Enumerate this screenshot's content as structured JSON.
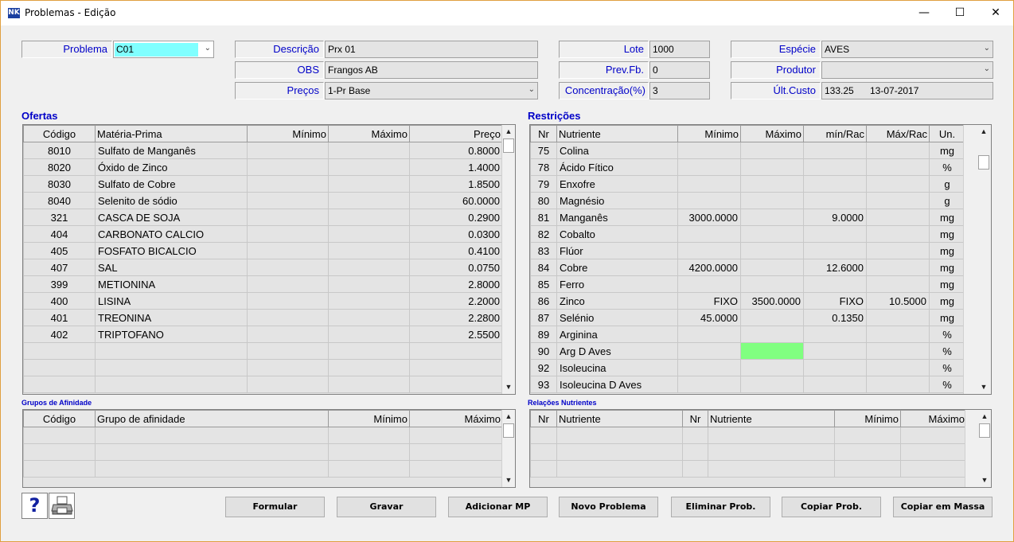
{
  "window": {
    "title": "Problemas - Edição",
    "icon_text": "NK",
    "controls": {
      "minimize": "—",
      "maximize": "☐",
      "close": "✕"
    }
  },
  "header": {
    "problema": {
      "label": "Problema",
      "value": "C01"
    },
    "descricao": {
      "label": "Descrição",
      "value": "Prx 01"
    },
    "obs": {
      "label": "OBS",
      "value": "Frangos AB"
    },
    "precos": {
      "label": "Preços",
      "value": "1-Pr Base"
    },
    "lote": {
      "label": "Lote",
      "value": "1000"
    },
    "prevfb": {
      "label": "Prev.Fb.",
      "value": "0"
    },
    "concentracao": {
      "label": "Concentração(%)",
      "value": "3"
    },
    "especie": {
      "label": "Espécie",
      "value": "AVES"
    },
    "produtor": {
      "label": "Produtor",
      "value": ""
    },
    "ultcusto": {
      "label": "Últ.Custo",
      "value": "133.25",
      "date": "13-07-2017"
    }
  },
  "ofertas": {
    "title": "Ofertas",
    "columns": [
      "Código",
      "Matéria-Prima",
      "Mínimo",
      "Máximo",
      "Preço"
    ],
    "rows": [
      [
        "8010",
        "Sulfato de Manganês",
        "",
        "",
        "0.8000"
      ],
      [
        "8020",
        "Óxido de Zinco",
        "",
        "",
        "1.4000"
      ],
      [
        "8030",
        "Sulfato de Cobre",
        "",
        "",
        "1.8500"
      ],
      [
        "8040",
        "Selenito de sódio",
        "",
        "",
        "60.0000"
      ],
      [
        "321",
        "CASCA DE SOJA",
        "",
        "",
        "0.2900"
      ],
      [
        "404",
        "CARBONATO CALCIO",
        "",
        "",
        "0.0300"
      ],
      [
        "405",
        "FOSFATO BICALCIO",
        "",
        "",
        "0.4100"
      ],
      [
        "407",
        "SAL",
        "",
        "",
        "0.0750"
      ],
      [
        "399",
        "METIONINA",
        "",
        "",
        "2.8000"
      ],
      [
        "400",
        "LISINA",
        "",
        "",
        "2.2000"
      ],
      [
        "401",
        "TREONINA",
        "",
        "",
        "2.2800"
      ],
      [
        "402",
        "TRIPTOFANO",
        "",
        "",
        "2.5500"
      ],
      [
        "",
        "",
        "",
        "",
        ""
      ],
      [
        "",
        "",
        "",
        "",
        ""
      ],
      [
        "",
        "",
        "",
        "",
        ""
      ]
    ]
  },
  "restricoes": {
    "title": "Restrições",
    "columns": [
      "Nr",
      "Nutriente",
      "Mínimo",
      "Máximo",
      "mín/Rac",
      "Máx/Rac",
      "Un."
    ],
    "rows": [
      [
        "75",
        "Colina",
        "",
        "",
        "",
        "",
        "mg"
      ],
      [
        "78",
        "Ácido Fítico",
        "",
        "",
        "",
        "",
        "%"
      ],
      [
        "79",
        "Enxofre",
        "",
        "",
        "",
        "",
        "g"
      ],
      [
        "80",
        "Magnésio",
        "",
        "",
        "",
        "",
        "g"
      ],
      [
        "81",
        "Manganês",
        "3000.0000",
        "",
        "9.0000",
        "",
        "mg"
      ],
      [
        "82",
        "Cobalto",
        "",
        "",
        "",
        "",
        "mg"
      ],
      [
        "83",
        "Flúor",
        "",
        "",
        "",
        "",
        "mg"
      ],
      [
        "84",
        "Cobre",
        "4200.0000",
        "",
        "12.6000",
        "",
        "mg"
      ],
      [
        "85",
        "Ferro",
        "",
        "",
        "",
        "",
        "mg"
      ],
      [
        "86",
        "Zinco",
        "FIXO",
        "3500.0000",
        "FIXO",
        "10.5000",
        "mg"
      ],
      [
        "87",
        "Selénio",
        "45.0000",
        "",
        "0.1350",
        "",
        "mg"
      ],
      [
        "89",
        "Arginina",
        "",
        "",
        "",
        "",
        "%"
      ],
      [
        "90",
        "Arg D Aves",
        "",
        "",
        "",
        "",
        "%"
      ],
      [
        "92",
        "Isoleucina",
        "",
        "",
        "",
        "",
        "%"
      ],
      [
        "93",
        "Isoleucina D Aves",
        "",
        "",
        "",
        "",
        "%"
      ]
    ],
    "highlight_color": "#80ff80"
  },
  "grupos": {
    "title": "Grupos de Afinidade",
    "columns": [
      "Código",
      "Grupo de afinidade",
      "Mínimo",
      "Máximo"
    ]
  },
  "relacoes": {
    "title": "Relações Nutrientes",
    "columns": [
      "Nr",
      "Nutriente",
      "Nr",
      "Nutriente",
      "Mínimo",
      "Máximo"
    ]
  },
  "buttons": {
    "help": "?",
    "formular": "Formular",
    "gravar": "Gravar",
    "adicionar": "Adicionar MP",
    "novo": "Novo Problema",
    "eliminar": "Eliminar Prob.",
    "copiar": "Copiar Prob.",
    "copiar_massa": "Copiar em Massa"
  },
  "colors": {
    "label_blue": "#0000c8",
    "problema_field": "#80ffff",
    "window_border": "#e0a040"
  }
}
